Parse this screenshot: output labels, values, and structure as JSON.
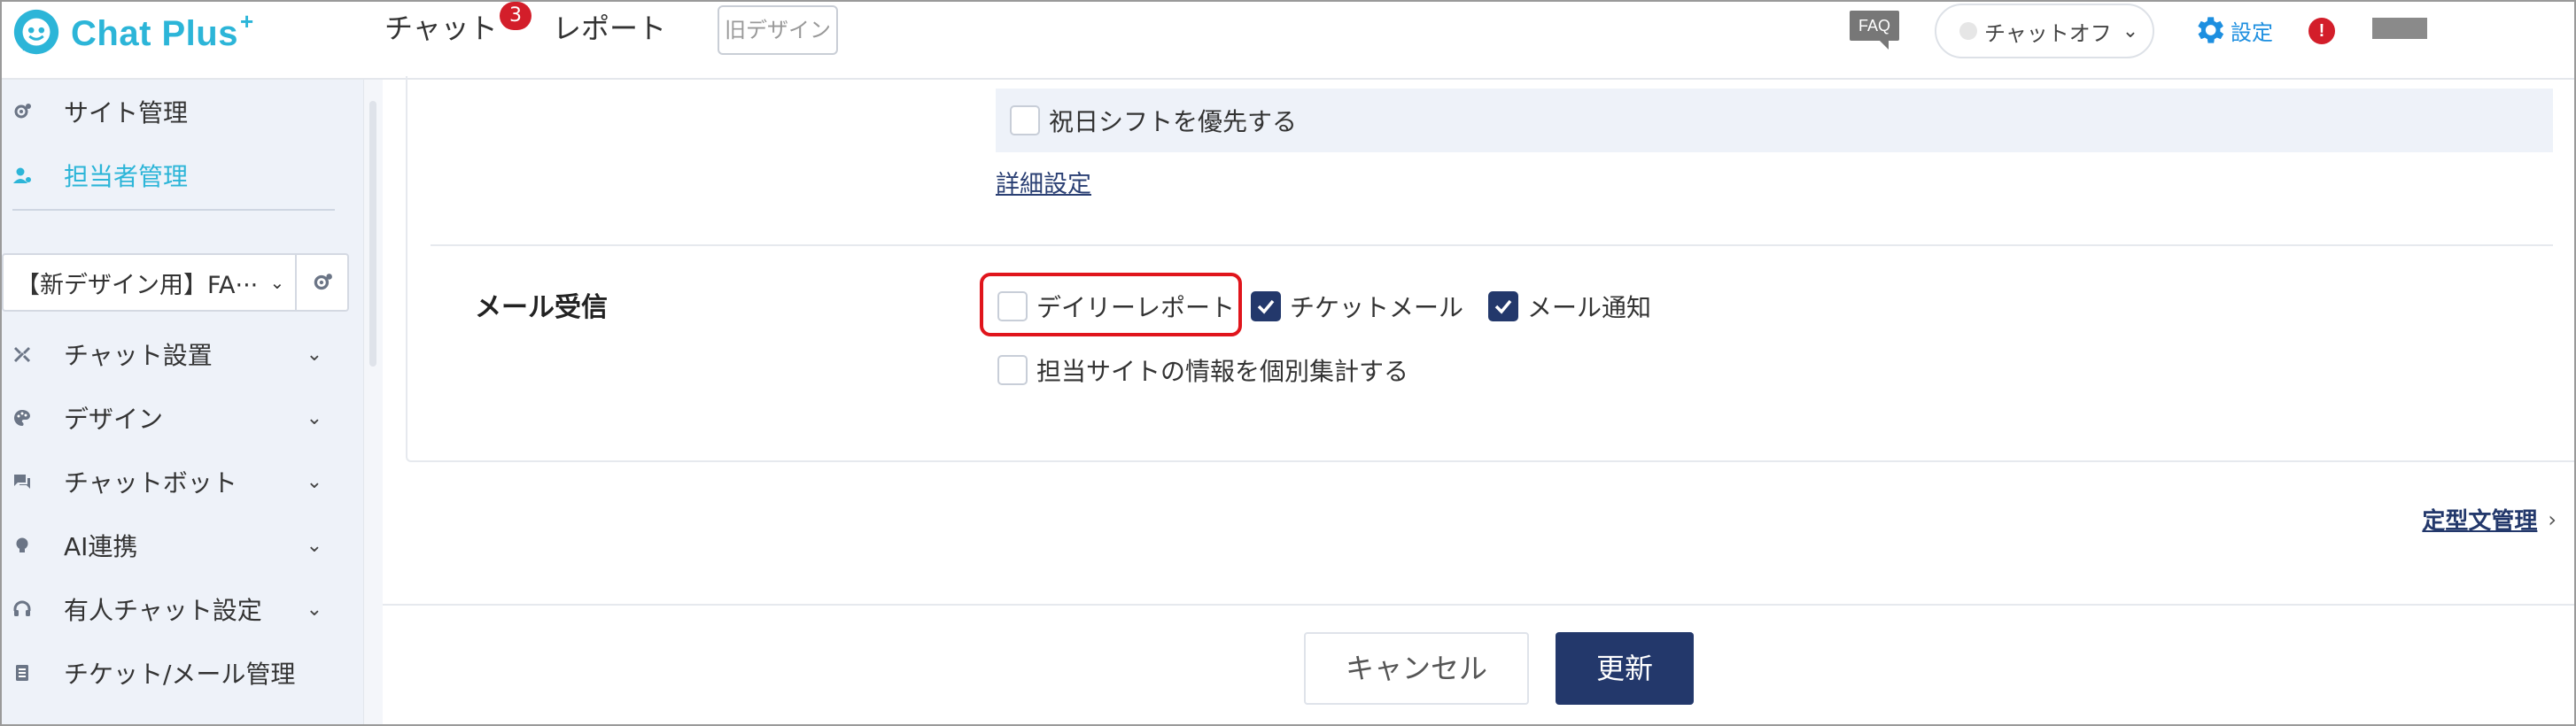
{
  "app": {
    "logo_text": "Chat Plus",
    "logo_plus": "+"
  },
  "header": {
    "nav_chat": "チャット",
    "chat_badge": "3",
    "nav_report": "レポート",
    "old_design": "旧デザイン",
    "faq": "FAQ",
    "chat_status": "チャットオフ",
    "settings": "設定",
    "alert": "!"
  },
  "sidebar": {
    "top_items": [
      {
        "label": "サイト管理",
        "icon": "gear-user-icon"
      },
      {
        "label": "担当者管理",
        "icon": "person-icon",
        "active": true
      }
    ],
    "site_select": "【新デザイン用】FA···",
    "menu": [
      {
        "label": "チャット設置",
        "icon": "tools-icon",
        "expandable": true
      },
      {
        "label": "デザイン",
        "icon": "palette-icon",
        "expandable": true
      },
      {
        "label": "チャットボット",
        "icon": "chat-bubbles-icon",
        "expandable": true
      },
      {
        "label": "AI連携",
        "icon": "bulb-icon",
        "expandable": true
      },
      {
        "label": "有人チャット設定",
        "icon": "headset-icon",
        "expandable": true
      },
      {
        "label": "チケット/メール管理",
        "icon": "document-icon",
        "expandable": false
      }
    ]
  },
  "main": {
    "holiday_shift": {
      "label": "祝日シフトを優先する",
      "checked": false
    },
    "detail_link": "詳細設定",
    "mail_section_label": "メール受信",
    "options": [
      {
        "label": "デイリーレポート",
        "checked": false
      },
      {
        "label": "チケットメール",
        "checked": true
      },
      {
        "label": "メール通知",
        "checked": true
      },
      {
        "label": "担当サイトの情報を個別集計する",
        "checked": false
      }
    ],
    "template_link": "定型文管理",
    "cancel_button": "キャンセル",
    "update_button": "更新"
  },
  "colors": {
    "brand": "#2cb5d8",
    "primary": "#23386b",
    "badge": "#d31e2a",
    "highlight": "#e0151c",
    "sidebar_bg": "#eef2f9"
  }
}
